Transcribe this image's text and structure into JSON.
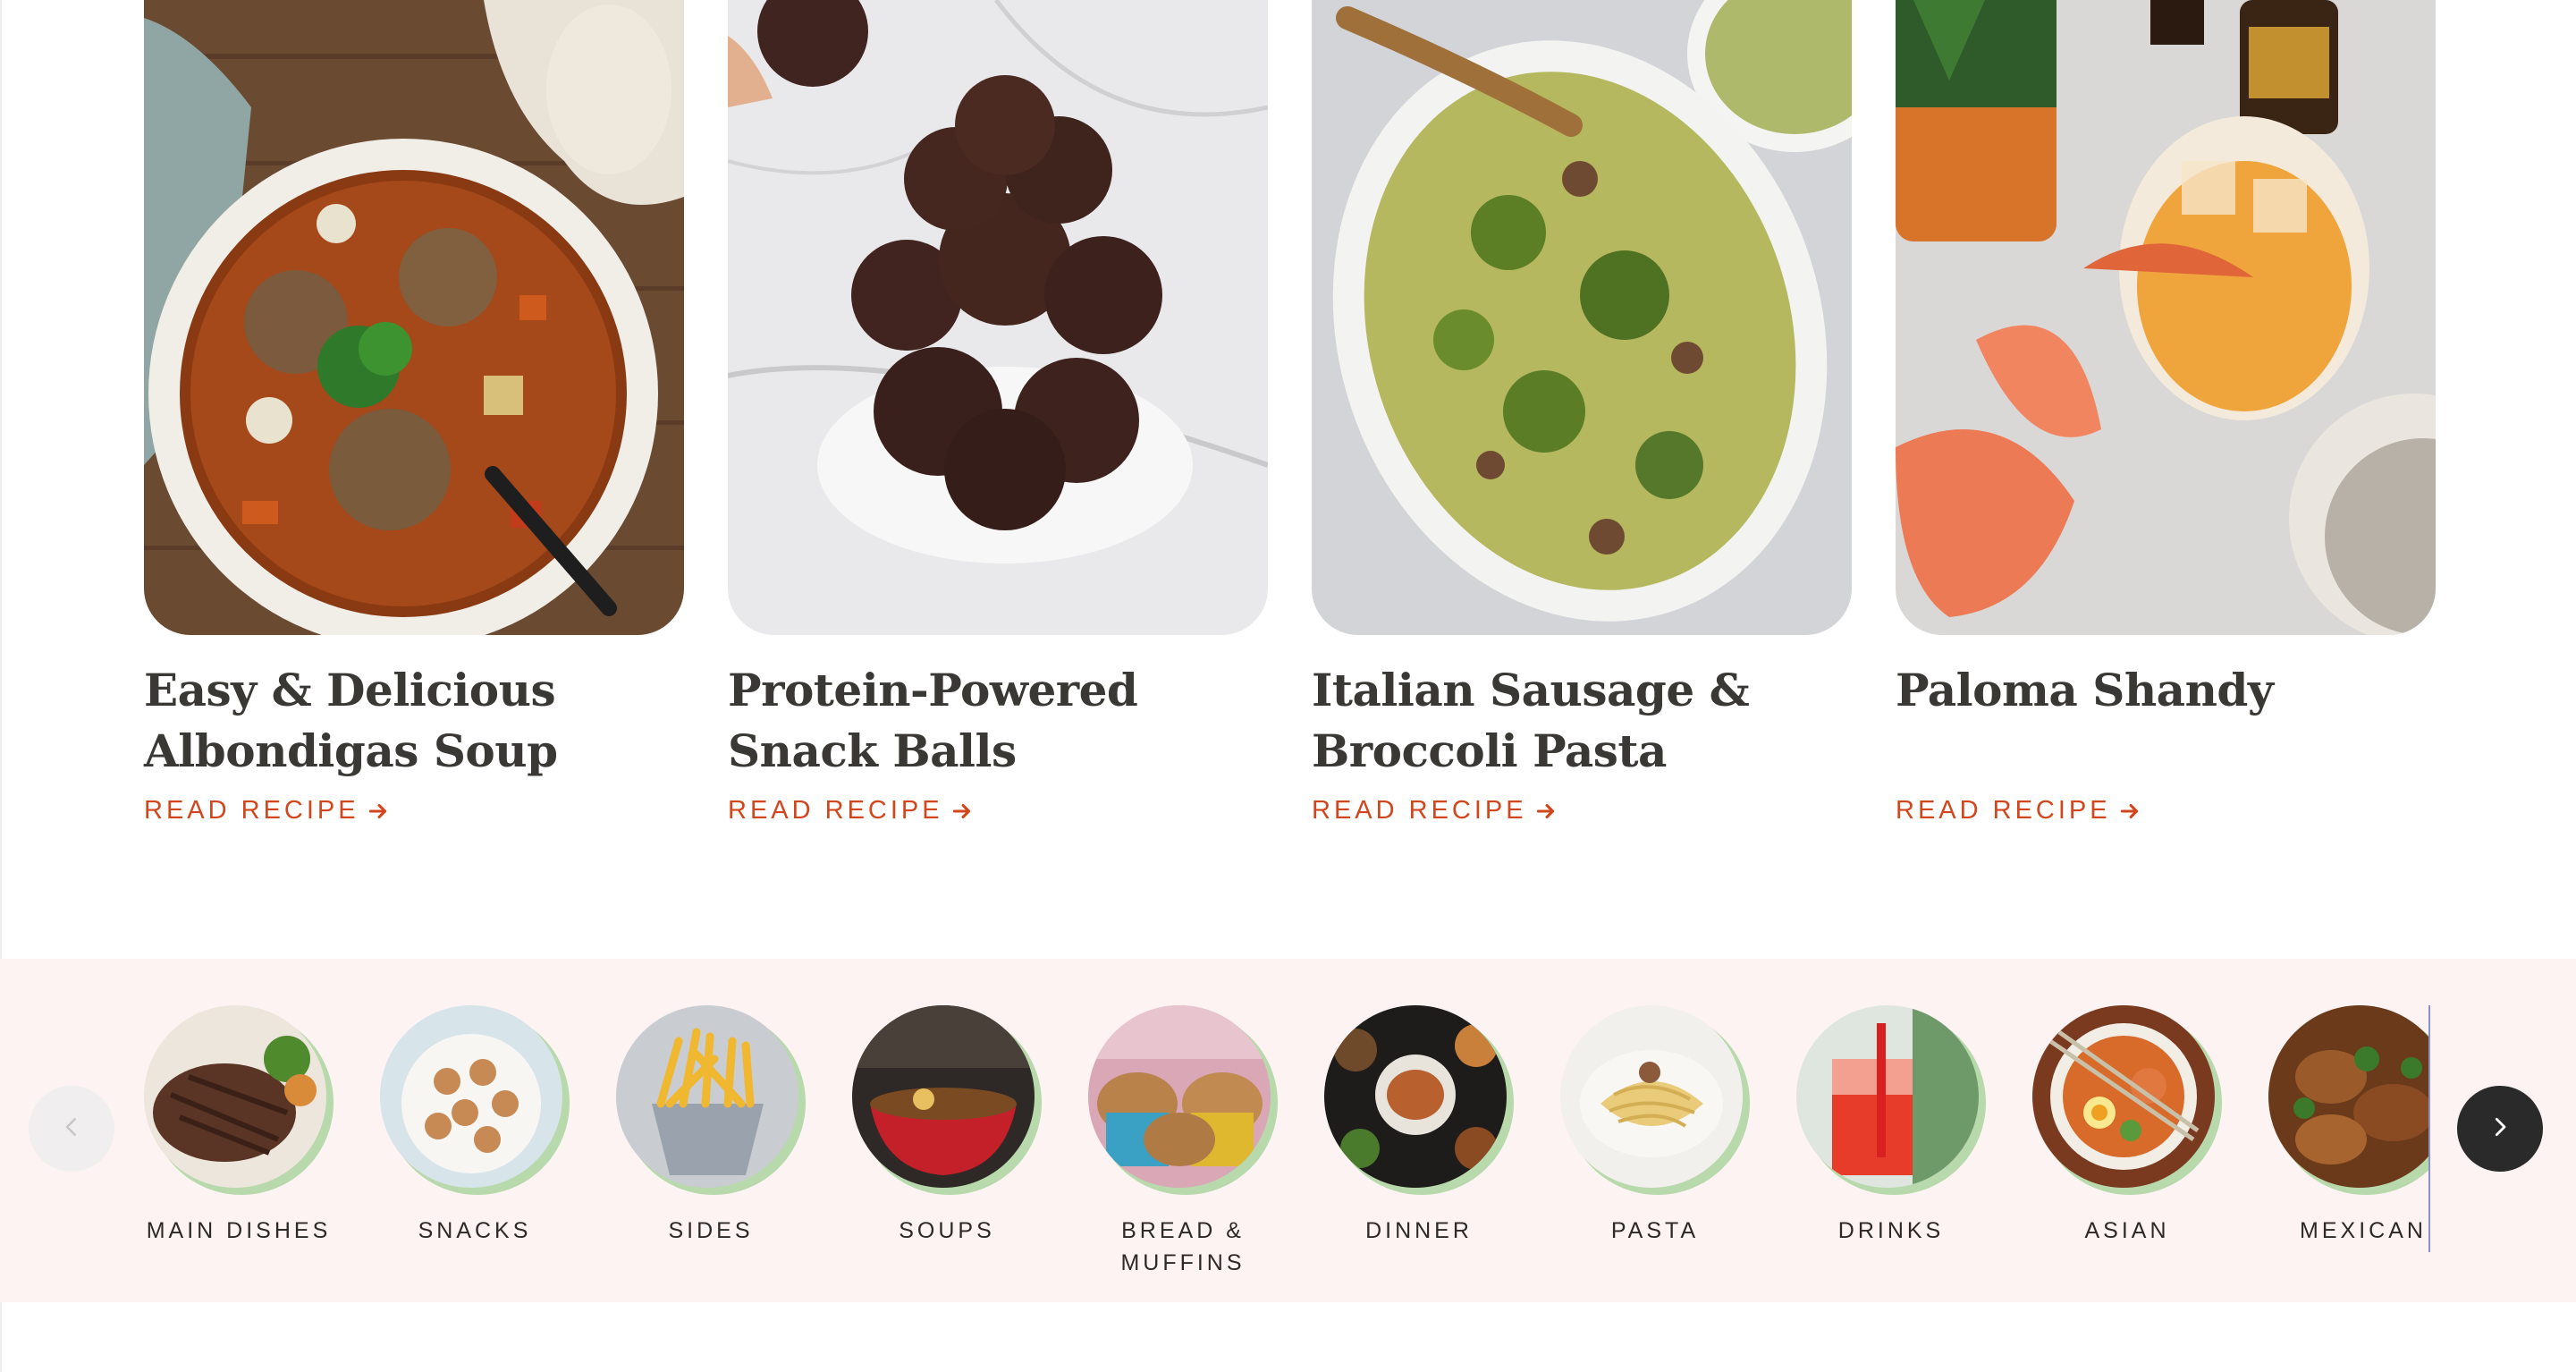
{
  "recipes": [
    {
      "title": "Easy & Delicious Albondigas Soup",
      "link_label": "READ RECIPE",
      "image": "albondigas-soup-photo"
    },
    {
      "title": "Protein-Powered Snack Balls",
      "link_label": "READ RECIPE",
      "image": "snack-balls-photo"
    },
    {
      "title": "Italian Sausage & Broccoli Pasta",
      "link_label": "READ RECIPE",
      "image": "sausage-pasta-photo"
    },
    {
      "title": "Paloma Shandy",
      "link_label": "READ RECIPE",
      "image": "paloma-shandy-photo"
    }
  ],
  "categories": [
    {
      "label": "MAIN DISHES",
      "image": "steak-photo"
    },
    {
      "label": "SNACKS",
      "image": "cookies-photo"
    },
    {
      "label": "SIDES",
      "image": "fries-photo"
    },
    {
      "label": "SOUPS",
      "image": "ramen-bowl-photo"
    },
    {
      "label": "BREAD & MUFFINS",
      "image": "muffins-photo"
    },
    {
      "label": "DINNER",
      "image": "dinner-spread-photo"
    },
    {
      "label": "PASTA",
      "image": "spaghetti-photo"
    },
    {
      "label": "DRINKS",
      "image": "red-drink-photo"
    },
    {
      "label": "ASIAN",
      "image": "noodle-bowl-photo"
    },
    {
      "label": "MEXICAN",
      "image": "mexican-dish-photo"
    }
  ],
  "carousel": {
    "prev_icon": "chevron-left-icon",
    "next_icon": "chevron-right-icon"
  },
  "colors": {
    "accent": "#d2461d",
    "band": "#fdf3f3",
    "ring": "#b8d9ab",
    "next_button": "#2a2a2a"
  }
}
